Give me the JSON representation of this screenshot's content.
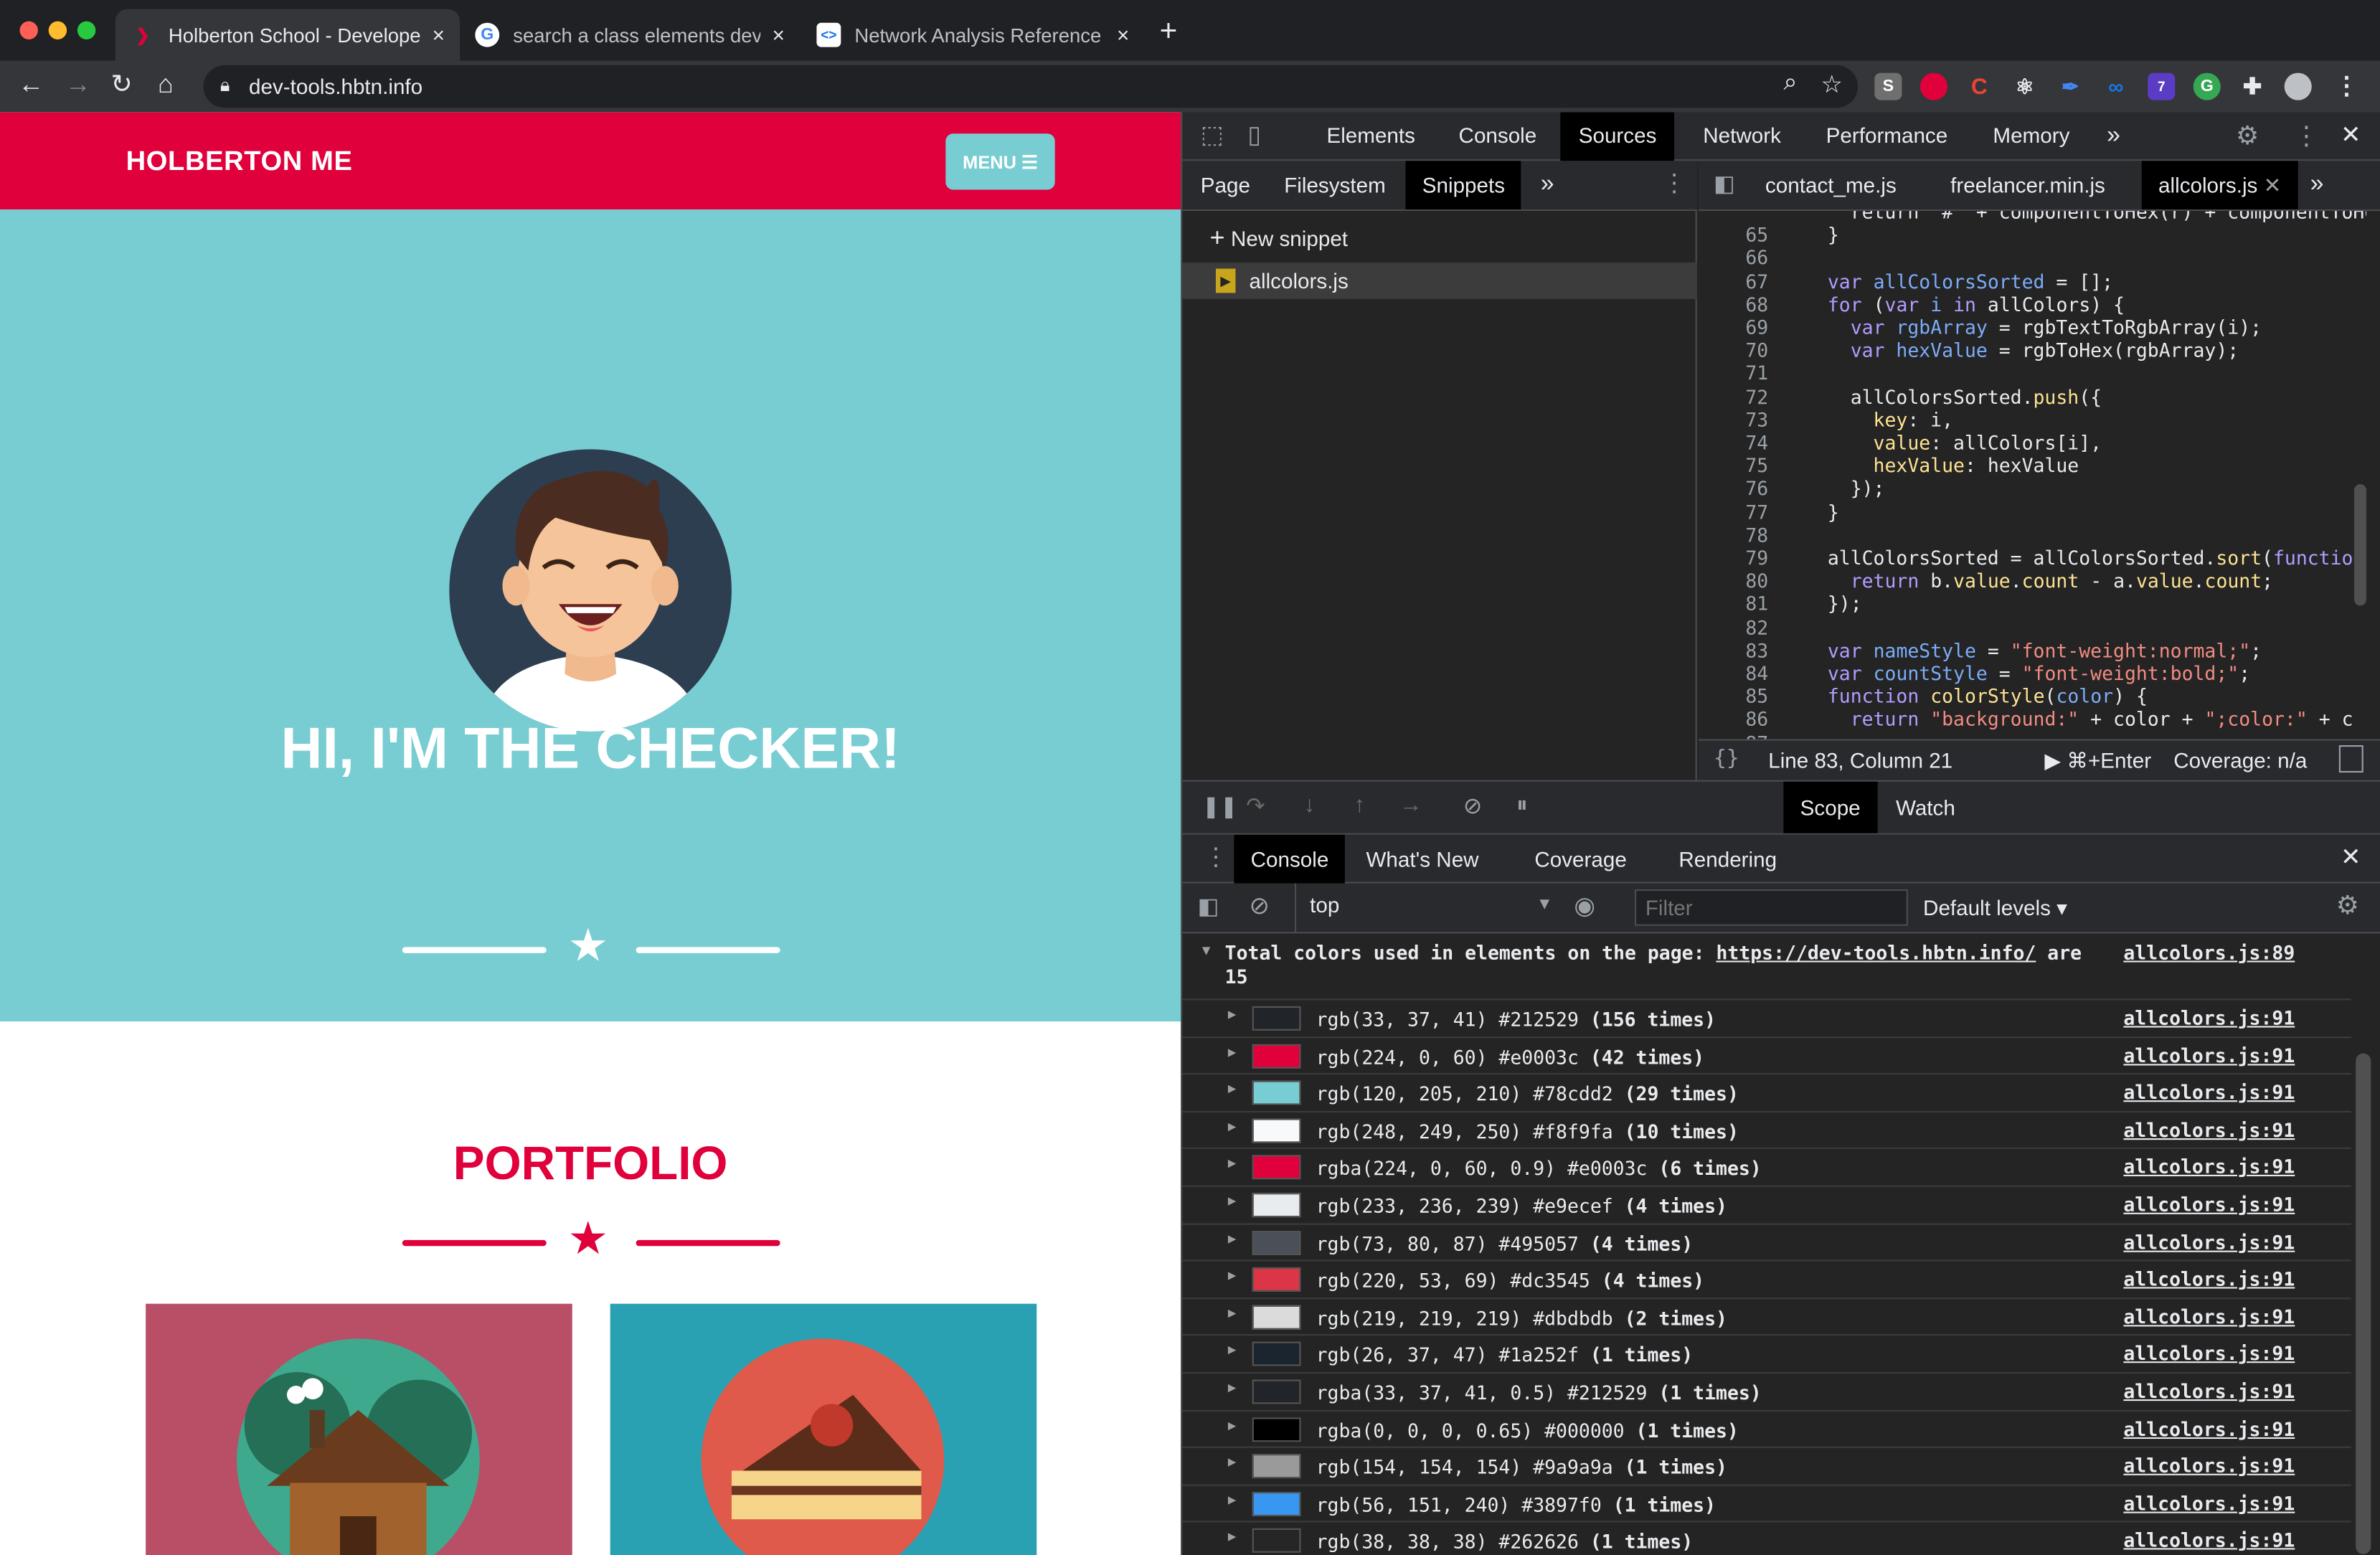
{
  "browser": {
    "tabs": [
      {
        "title": "Holberton School - Developer t",
        "favicon": "holberton-icon",
        "active": true
      },
      {
        "title": "search a class elements devto",
        "favicon": "google-icon",
        "active": false
      },
      {
        "title": "Network Analysis Reference |",
        "favicon": "devtools-icon",
        "active": false
      }
    ],
    "url": "dev-tools.hbtn.info",
    "new_tab": "+",
    "close": "×",
    "ext_labels": [
      "S",
      "C"
    ],
    "ext_badge": "7"
  },
  "site": {
    "brand": "HOLBERTON ME",
    "menu_label": "MENU ☰",
    "hero_title": "HI, I'M THE CHECKER!",
    "portfolio_title": "PORTFOLIO",
    "star": "★"
  },
  "devtools": {
    "main_tabs": [
      "Elements",
      "Console",
      "Sources",
      "Network",
      "Performance",
      "Memory"
    ],
    "active_main_tab": "Sources",
    "more": "»",
    "close": "✕",
    "sources_tabs": [
      "Page",
      "Filesystem",
      "Snippets"
    ],
    "active_sources_tab": "Snippets",
    "new_snippet": "New snippet",
    "plus": "+",
    "snippet_file": "allcolors.js",
    "editor_tabs": [
      "contact_me.js",
      "freelancer.min.js",
      "allcolors.js"
    ],
    "active_editor_tab": "allcolors.js",
    "code_lines": [
      {
        "n": "",
        "h": "    return \"#\" + componentToHex(r) + componentToHex("
      },
      {
        "n": "65",
        "h": "  }"
      },
      {
        "n": "66",
        "h": ""
      },
      {
        "n": "67",
        "h": "  <span class='kw'>var</span> <span class='vr'>allColorsSorted</span> = [];"
      },
      {
        "n": "68",
        "h": "  <span class='kw'>for</span> (<span class='kw'>var</span> <span class='vr'>i</span> <span class='kw'>in</span> allColors) {"
      },
      {
        "n": "69",
        "h": "    <span class='kw'>var</span> <span class='vr'>rgbArray</span> = rgbTextToRgbArray(i);"
      },
      {
        "n": "70",
        "h": "    <span class='kw'>var</span> <span class='vr'>hexValue</span> = rgbToHex(rgbArray);"
      },
      {
        "n": "71",
        "h": ""
      },
      {
        "n": "72",
        "h": "    allColorsSorted.<span class='fn'>push</span>({"
      },
      {
        "n": "73",
        "h": "      <span class='pr'>key</span>: i,"
      },
      {
        "n": "74",
        "h": "      <span class='pr'>value</span>: allColors[i],"
      },
      {
        "n": "75",
        "h": "      <span class='pr'>hexValue</span>: hexValue"
      },
      {
        "n": "76",
        "h": "    });"
      },
      {
        "n": "77",
        "h": "  }"
      },
      {
        "n": "78",
        "h": ""
      },
      {
        "n": "79",
        "h": "  allColorsSorted = allColorsSorted.<span class='fn'>sort</span>(<span class='kw'>function</span>"
      },
      {
        "n": "80",
        "h": "    <span class='kw'>return</span> b.<span class='pr'>value</span>.<span class='pr'>count</span> - a.<span class='pr'>value</span>.<span class='pr'>count</span>;"
      },
      {
        "n": "81",
        "h": "  });"
      },
      {
        "n": "82",
        "h": ""
      },
      {
        "n": "83",
        "h": "  <span class='kw'>var</span> <span class='vr'>nameStyle</span> = <span class='st'>\"font-weight:normal;\"</span>;"
      },
      {
        "n": "84",
        "h": "  <span class='kw'>var</span> <span class='vr'>countStyle</span> = <span class='st'>\"font-weight:bold;\"</span>;"
      },
      {
        "n": "85",
        "h": "  <span class='kw'>function</span> <span class='fn'>colorStyle</span>(<span class='vr'>color</span>) {"
      },
      {
        "n": "86",
        "h": "    <span class='kw'>return</span> <span class='st'>\"background:\"</span> + color + <span class='st'>\";color:\"</span> + c"
      },
      {
        "n": "87",
        "h": ""
      }
    ],
    "status_braces": "{}",
    "status_position": "Line 83, Column 21",
    "status_run": "▶ ⌘+Enter",
    "status_coverage": "Coverage: n/a",
    "debug_tabs": [
      "Scope",
      "Watch"
    ],
    "active_debug_tab": "Scope",
    "drawer_tabs": [
      "Console",
      "What's New",
      "Coverage",
      "Rendering"
    ],
    "active_drawer_tab": "Console",
    "context": "top",
    "filter_placeholder": "Filter",
    "levels": "Default levels ▾",
    "summary_line1": "Total colors used in elements on the page: ",
    "summary_link": "https://dev-tools.hbtn.info/",
    "summary_tail": " are",
    "summary_count": "15",
    "summary_src": "allcolors.js:89",
    "summary_toggle": "▼",
    "row_toggle": "▶",
    "rows": [
      {
        "swatch": "#212529",
        "text": "rgb(33, 37, 41) #212529 ",
        "count": "(156 times)",
        "src": "allcolors.js:91"
      },
      {
        "swatch": "#e0003c",
        "text": "rgb(224, 0, 60) #e0003c ",
        "count": "(42 times)",
        "src": "allcolors.js:91"
      },
      {
        "swatch": "#78cdd2",
        "text": "rgb(120, 205, 210) #78cdd2 ",
        "count": "(29 times)",
        "src": "allcolors.js:91"
      },
      {
        "swatch": "#f8f9fa",
        "text": "rgb(248, 249, 250) #f8f9fa ",
        "count": "(10 times)",
        "src": "allcolors.js:91"
      },
      {
        "swatch": "#e0003c",
        "text": "rgba(224, 0, 60, 0.9) #e0003c ",
        "count": "(6 times)",
        "src": "allcolors.js:91"
      },
      {
        "swatch": "#e9ecef",
        "text": "rgb(233, 236, 239) #e9ecef ",
        "count": "(4 times)",
        "src": "allcolors.js:91"
      },
      {
        "swatch": "#495057",
        "text": "rgb(73, 80, 87) #495057 ",
        "count": "(4 times)",
        "src": "allcolors.js:91"
      },
      {
        "swatch": "#dc3545",
        "text": "rgb(220, 53, 69) #dc3545 ",
        "count": "(4 times)",
        "src": "allcolors.js:91"
      },
      {
        "swatch": "#dbdbdb",
        "text": "rgb(219, 219, 219) #dbdbdb ",
        "count": "(2 times)",
        "src": "allcolors.js:91"
      },
      {
        "swatch": "#1a252f",
        "text": "rgb(26, 37, 47) #1a252f ",
        "count": "(1 times)",
        "src": "allcolors.js:91"
      },
      {
        "swatch": "#212529",
        "text": "rgba(33, 37, 41, 0.5) #212529 ",
        "count": "(1 times)",
        "src": "allcolors.js:91"
      },
      {
        "swatch": "#000000",
        "text": "rgba(0, 0, 0, 0.65) #000000 ",
        "count": "(1 times)",
        "src": "allcolors.js:91"
      },
      {
        "swatch": "#9a9a9a",
        "text": "rgb(154, 154, 154) #9a9a9a ",
        "count": "(1 times)",
        "src": "allcolors.js:91"
      },
      {
        "swatch": "#3897f0",
        "text": "rgb(56, 151, 240) #3897f0 ",
        "count": "(1 times)",
        "src": "allcolors.js:91"
      },
      {
        "swatch": "#262626",
        "text": "rgb(38, 38, 38) #262626 ",
        "count": "(1 times)",
        "src": "allcolors.js:91"
      }
    ]
  },
  "colors": {
    "brand": "#e0003c",
    "teal": "#78cdd2",
    "devtools_bg": "#242424"
  }
}
